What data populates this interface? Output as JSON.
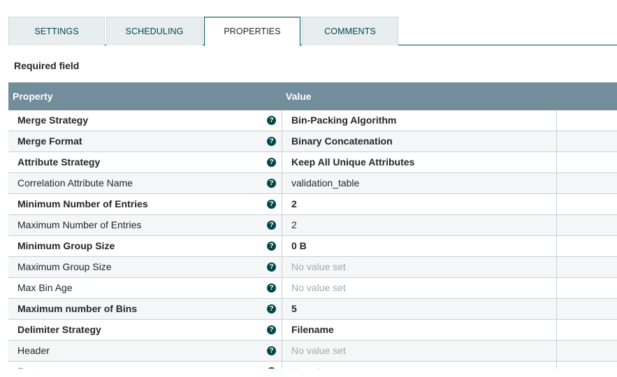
{
  "tabs": [
    {
      "label": "SETTINGS",
      "active": false
    },
    {
      "label": "SCHEDULING",
      "active": false
    },
    {
      "label": "PROPERTIES",
      "active": true
    },
    {
      "label": "COMMENTS",
      "active": false
    }
  ],
  "required_label": "Required field",
  "table": {
    "headers": {
      "property": "Property",
      "value": "Value"
    },
    "rows": [
      {
        "name": "Merge Strategy",
        "required": true,
        "value": "Bin-Packing Algorithm",
        "set": true
      },
      {
        "name": "Merge Format",
        "required": true,
        "value": "Binary Concatenation",
        "set": true
      },
      {
        "name": "Attribute Strategy",
        "required": true,
        "value": "Keep All Unique Attributes",
        "set": true
      },
      {
        "name": "Correlation Attribute Name",
        "required": false,
        "value": "validation_table",
        "set": true
      },
      {
        "name": "Minimum Number of Entries",
        "required": true,
        "value": "2",
        "set": true
      },
      {
        "name": "Maximum Number of Entries",
        "required": false,
        "value": "2",
        "set": true
      },
      {
        "name": "Minimum Group Size",
        "required": true,
        "value": "0 B",
        "set": true
      },
      {
        "name": "Maximum Group Size",
        "required": false,
        "value": "No value set",
        "set": false
      },
      {
        "name": "Max Bin Age",
        "required": false,
        "value": "No value set",
        "set": false
      },
      {
        "name": "Maximum number of Bins",
        "required": true,
        "value": "5",
        "set": true
      },
      {
        "name": "Delimiter Strategy",
        "required": true,
        "value": "Filename",
        "set": true
      },
      {
        "name": "Header",
        "required": false,
        "value": "No value set",
        "set": false
      },
      {
        "name": "Footer",
        "required": false,
        "value": "No value set",
        "set": false
      }
    ]
  },
  "icons": {
    "help": "question-circle-icon",
    "help_glyph": "?"
  },
  "colors": {
    "accent": "#004849",
    "header_bg": "#728e9b",
    "tab_bg": "#e8edf0",
    "row_alt": "#f4f6f7",
    "unset_text": "#a8a8a8"
  }
}
